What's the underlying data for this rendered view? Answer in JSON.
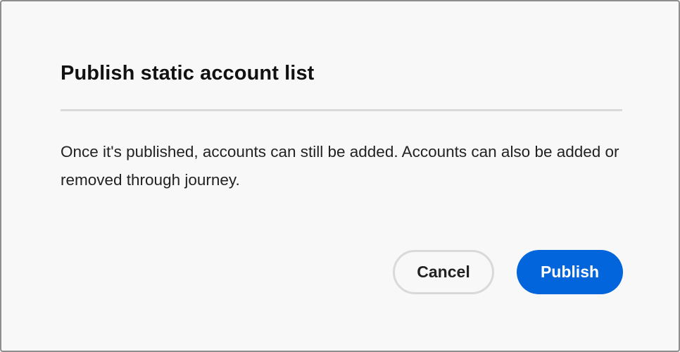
{
  "dialog": {
    "title": "Publish static account list",
    "body": "Once it's published, accounts can still be added. Accounts can also be added or removed through journey.",
    "buttons": {
      "cancel_label": "Cancel",
      "publish_label": "Publish"
    }
  },
  "colors": {
    "background": "#f8f8f8",
    "accent": "#0265dc",
    "divider": "#dadada"
  }
}
